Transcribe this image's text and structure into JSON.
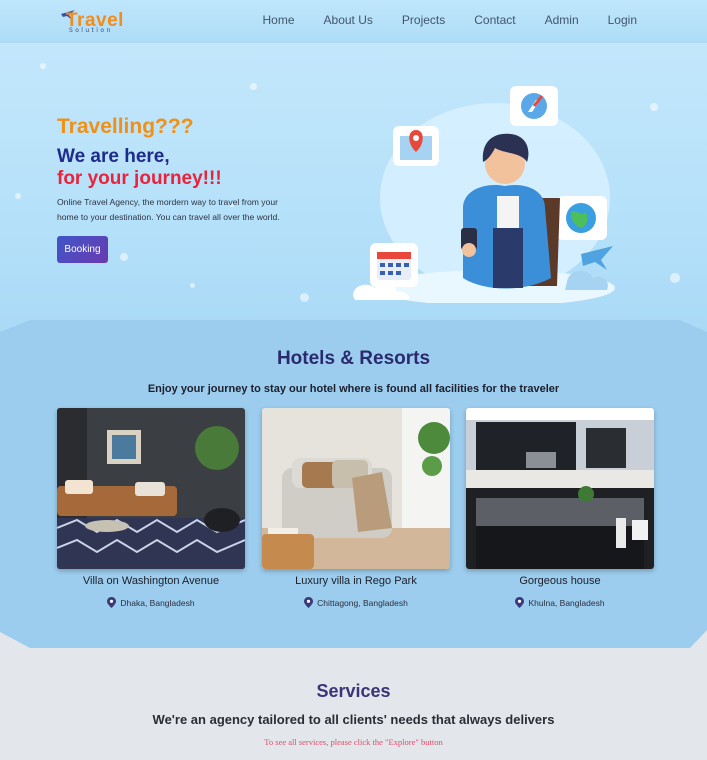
{
  "brand": {
    "name": "Travel",
    "tagline": "Solution"
  },
  "nav": {
    "items": [
      "Home",
      "About Us",
      "Projects",
      "Contact",
      "Admin",
      "Login"
    ]
  },
  "hero": {
    "question": "Travelling???",
    "headline": "We are here,",
    "headline_accent": "for your journey!!!",
    "description": "Online Travel Agency, the mordern way to travel from your home to your destination. You can travel all over the world.",
    "button": "Booking"
  },
  "hotels": {
    "title": "Hotels & Resorts",
    "subtitle": "Enjoy your journey to stay our hotel where is found all facilities for the traveler",
    "cards": [
      {
        "name": "Villa on Washington Avenue",
        "location": "Dhaka, Bangladesh"
      },
      {
        "name": "Luxury villa in Rego Park",
        "location": "Chittagong, Bangladesh"
      },
      {
        "name": "Gorgeous house",
        "location": "Khulna, Bangladesh"
      }
    ]
  },
  "services": {
    "title": "Services",
    "subtitle": "We're an agency tailored to all clients' needs that always delivers",
    "note": "To see all services, please click the \"Explore\" button"
  },
  "colors": {
    "accent_orange": "#f09016",
    "accent_navy": "#1f2a8a",
    "accent_red": "#e8243c",
    "section_blue": "#9ccdee"
  }
}
